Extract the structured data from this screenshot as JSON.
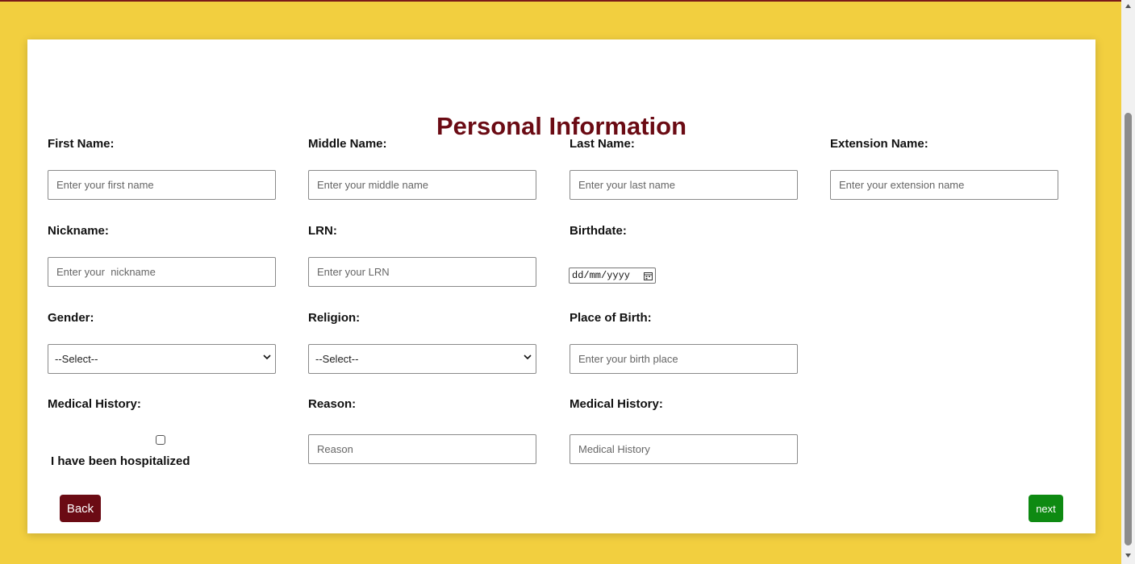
{
  "page": {
    "title": "Personal Information",
    "colors": {
      "page_bg": "#f2cf3f",
      "title": "#6b0b14",
      "back_button": "#6b0b14",
      "next_button": "#0e8a12"
    }
  },
  "fields": {
    "first_name": {
      "label": "First Name:",
      "placeholder": "Enter your first name",
      "value": ""
    },
    "middle_name": {
      "label": "Middle Name:",
      "placeholder": "Enter your middle name",
      "value": ""
    },
    "last_name": {
      "label": "Last Name:",
      "placeholder": "Enter your last name",
      "value": ""
    },
    "extension_name": {
      "label": "Extension Name:",
      "placeholder": "Enter your extension name",
      "value": ""
    },
    "nickname": {
      "label": "Nickname:",
      "placeholder": "Enter your  nickname",
      "value": ""
    },
    "lrn": {
      "label": "LRN:",
      "placeholder": "Enter your LRN",
      "value": ""
    },
    "birthdate": {
      "label": "Birthdate:",
      "value": "dd/mm/yyyy",
      "icon": "calendar-icon"
    },
    "gender": {
      "label": "Gender:",
      "selected": "--Select--",
      "icon": "chevron-down-icon"
    },
    "religion": {
      "label": "Religion:",
      "selected": "--Select--",
      "icon": "chevron-down-icon"
    },
    "birth_place": {
      "label": "Place of Birth:",
      "placeholder": "Enter your birth place",
      "value": ""
    },
    "medical_history_check": {
      "label": "Medical History:",
      "checkbox_label": "I have been hospitalized",
      "checked": false
    },
    "reason": {
      "label": "Reason:",
      "placeholder": "Reason",
      "value": ""
    },
    "medical_history": {
      "label": "Medical History:",
      "placeholder": "Medical History",
      "value": ""
    }
  },
  "buttons": {
    "back": "Back",
    "next": "next"
  }
}
